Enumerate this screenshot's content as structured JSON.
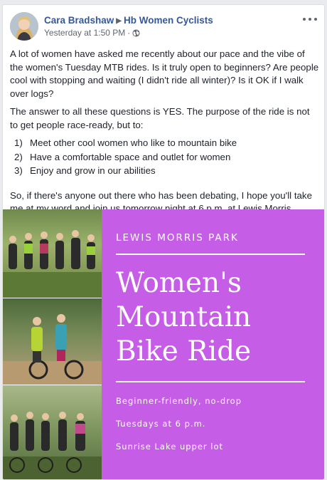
{
  "post": {
    "author": "Cara Bradshaw",
    "group": "Hb Women Cyclists",
    "timestamp": "Yesterday at 1:50 PM",
    "separator": "·",
    "intro": "A lot of women have asked me recently about our pace and the vibe of the women's Tuesday MTB rides. Is it truly open to beginners? Are people cool with stopping and waiting (I didn't ride all winter)? Is it OK if I walk over logs?",
    "answer": "The answer to all these questions is YES. The purpose of the ride is not to get people race-ready, but to:",
    "list": [
      {
        "num": "1)",
        "text": "Meet other cool women who like to mountain bike"
      },
      {
        "num": "2)",
        "text": "Have a comfortable space and outlet for women"
      },
      {
        "num": "3)",
        "text": "Enjoy and grow in our abilities"
      }
    ],
    "closing": "So, if there's anyone out there who has been debating, I hope you'll take me at my word and join us tomorrow night at 6 p.m. at Lewis Morris sunrise upper lot!"
  },
  "flyer": {
    "park": "LEWIS MORRIS PARK",
    "title_lines": [
      "Women's",
      "Mountain",
      "Bike Ride"
    ],
    "details": [
      "Beginner-friendly, no-drop",
      "Tuesdays at 6 p.m.",
      "Sunrise Lake upper lot"
    ],
    "accent_color": "#c65de6"
  },
  "icons": {
    "privacy": "globe-icon",
    "menu": "more-options-icon",
    "group_arrow": "triangle-right-icon"
  },
  "colors": {
    "link": "#365899",
    "meta": "#606770",
    "text": "#1d2129"
  }
}
